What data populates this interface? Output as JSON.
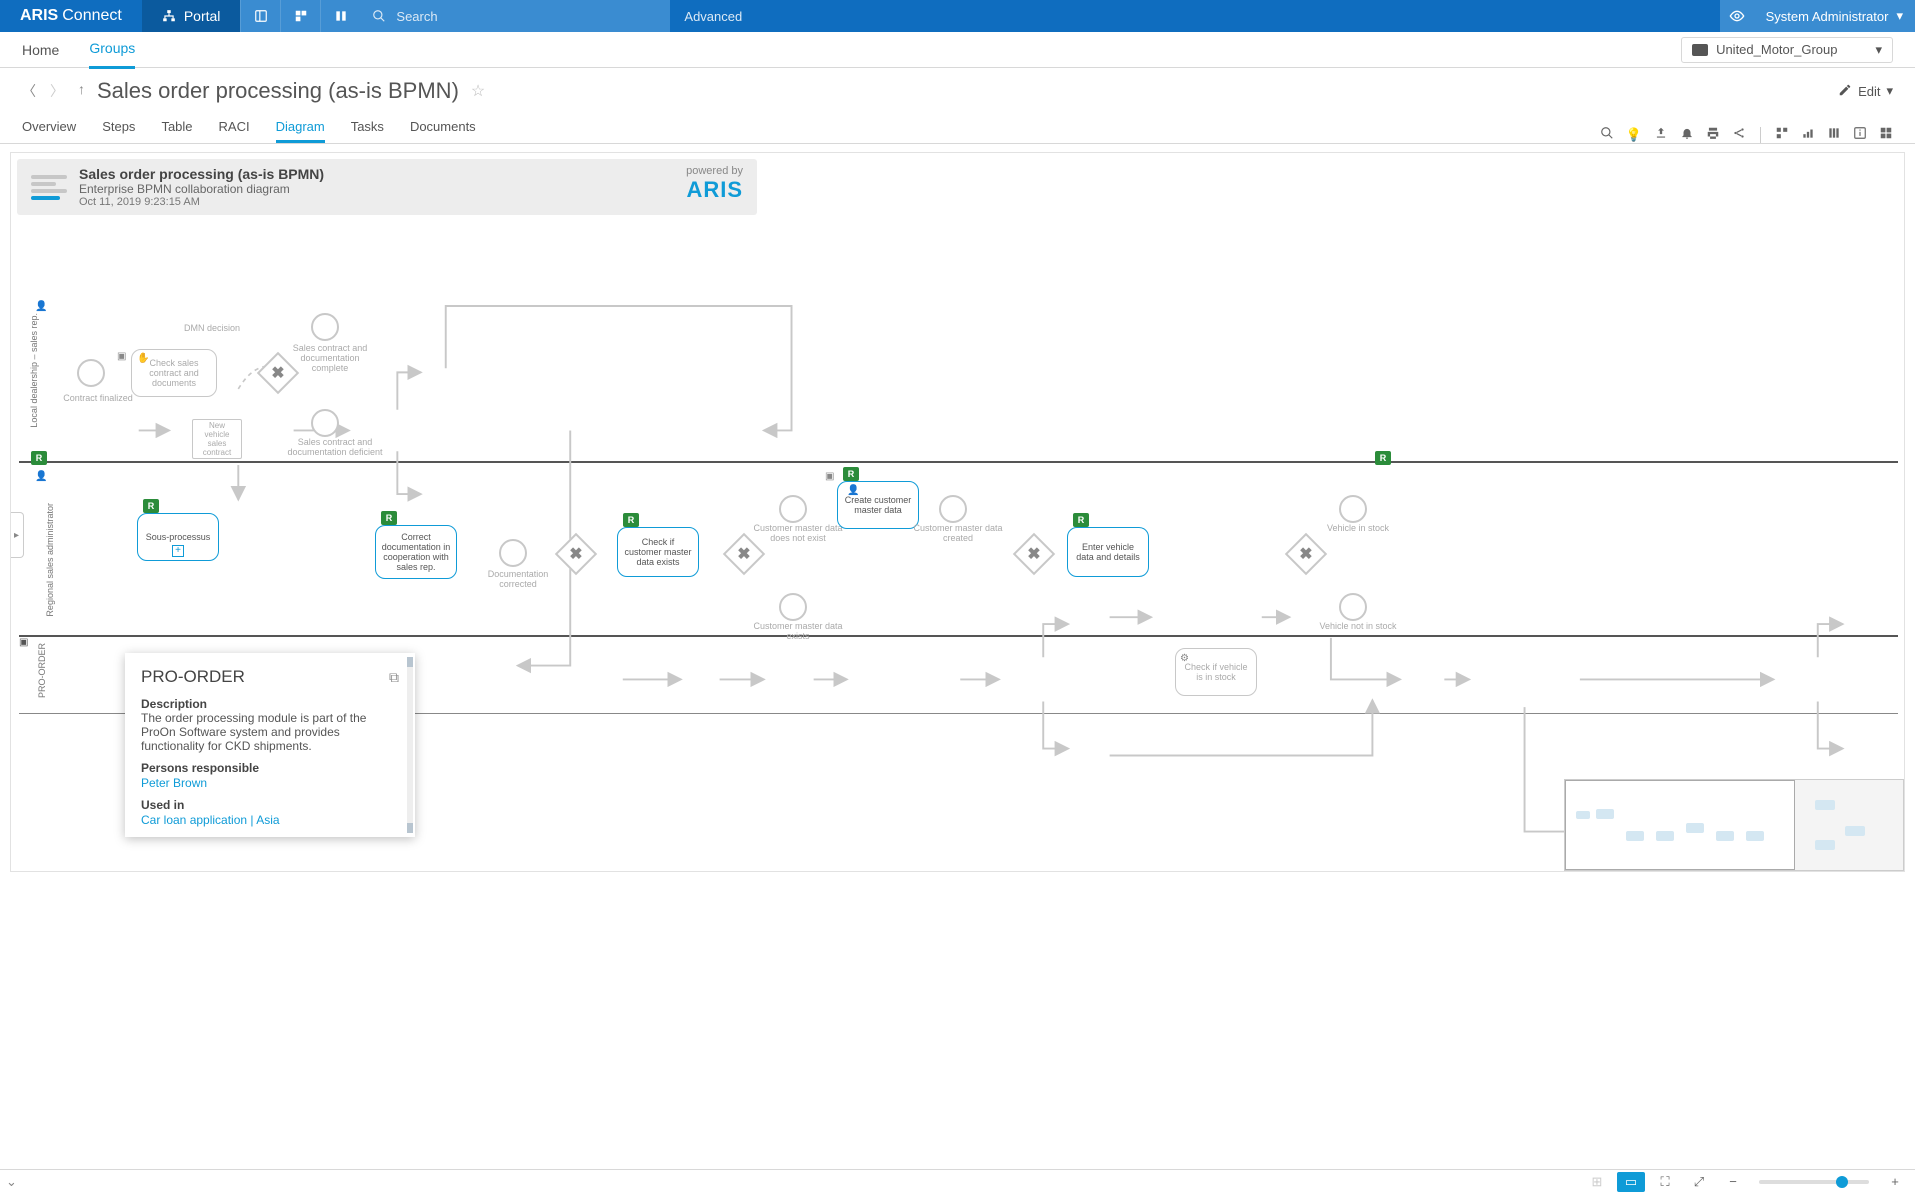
{
  "brand": {
    "bold": "ARIS",
    "light": "Connect"
  },
  "top": {
    "portal": "Portal",
    "search_placeholder": "Search",
    "advanced": "Advanced",
    "user": "System Administrator",
    "org": "United_Motor_Group"
  },
  "subnav": {
    "home": "Home",
    "groups": "Groups"
  },
  "title": "Sales order processing (as-is BPMN)",
  "edit": "Edit",
  "tabs": [
    "Overview",
    "Steps",
    "Table",
    "RACI",
    "Diagram",
    "Tasks",
    "Documents"
  ],
  "active_tab": "Diagram",
  "info": {
    "title": "Sales order processing (as-is BPMN)",
    "subtitle": "Enterprise BPMN collaboration diagram",
    "date": "Oct 11, 2019 9:23:15 AM",
    "powered": "powered by",
    "aris": "ARIS"
  },
  "lanes": {
    "top": "Local dealership – sales rep.",
    "mid": "Regional sales administrator",
    "bot": "PRO-ORDER"
  },
  "nodes": {
    "dmn": "DMN decision",
    "check": "Check sales contract and documents",
    "contract_fin": "Contract finalized",
    "new_vehicle": "New vehicle sales contract",
    "complete": "Sales contract and documentation complete",
    "deficient": "Sales contract and documentation deficient",
    "sous": "Sous-processus",
    "correct": "Correct documentation in cooperation with sales rep.",
    "doc_corrected": "Documentation corrected",
    "check_exists": "Check if customer master data exists",
    "not_exist": "Customer master data does not exist",
    "exists": "Customer master data exists",
    "create": "Create customer master data",
    "created": "Customer master data created",
    "enter": "Enter vehicle data and details",
    "instock": "Vehicle in stock",
    "notstock": "Vehicle not in stock",
    "check_stock": "Check if vehicle is in stock"
  },
  "popup": {
    "title": "PRO-ORDER",
    "desc_label": "Description",
    "desc": "The order processing module is part of the ProOn Software system and provides functionality for CKD shipments.",
    "persons_label": "Persons responsible",
    "person": "Peter Brown",
    "used_label": "Used in",
    "used": "Car loan application | Asia"
  },
  "flag": "R"
}
